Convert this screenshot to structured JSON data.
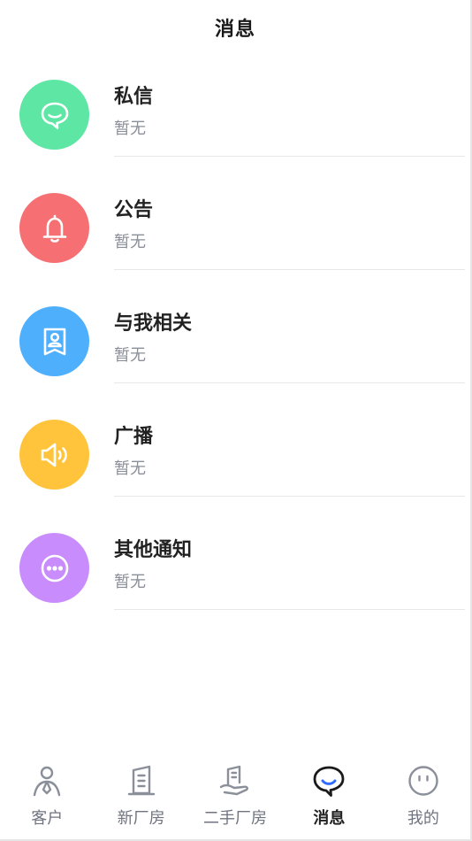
{
  "header": {
    "title": "消息"
  },
  "messages": [
    {
      "title": "私信",
      "subtitle": "暂无",
      "icon": "chat-bubble-icon",
      "color": "#5ee6a4"
    },
    {
      "title": "公告",
      "subtitle": "暂无",
      "icon": "bell-icon",
      "color": "#f56f73"
    },
    {
      "title": "与我相关",
      "subtitle": "暂无",
      "icon": "contact-card-icon",
      "color": "#4eaffd"
    },
    {
      "title": "广播",
      "subtitle": "暂无",
      "icon": "speaker-icon",
      "color": "#ffc43c"
    },
    {
      "title": "其他通知",
      "subtitle": "暂无",
      "icon": "more-dots-icon",
      "color": "#c98cfd"
    }
  ],
  "tabbar": {
    "active_color": "#1a1a1a",
    "accent_color": "#2f6bff",
    "inactive_color": "#8a8f99",
    "tabs": [
      {
        "label": "客户",
        "icon": "customer-icon",
        "active": false
      },
      {
        "label": "新厂房",
        "icon": "new-factory-icon",
        "active": false
      },
      {
        "label": "二手厂房",
        "icon": "used-factory-icon",
        "active": false
      },
      {
        "label": "消息",
        "icon": "message-icon",
        "active": true
      },
      {
        "label": "我的",
        "icon": "profile-icon",
        "active": false
      }
    ]
  }
}
